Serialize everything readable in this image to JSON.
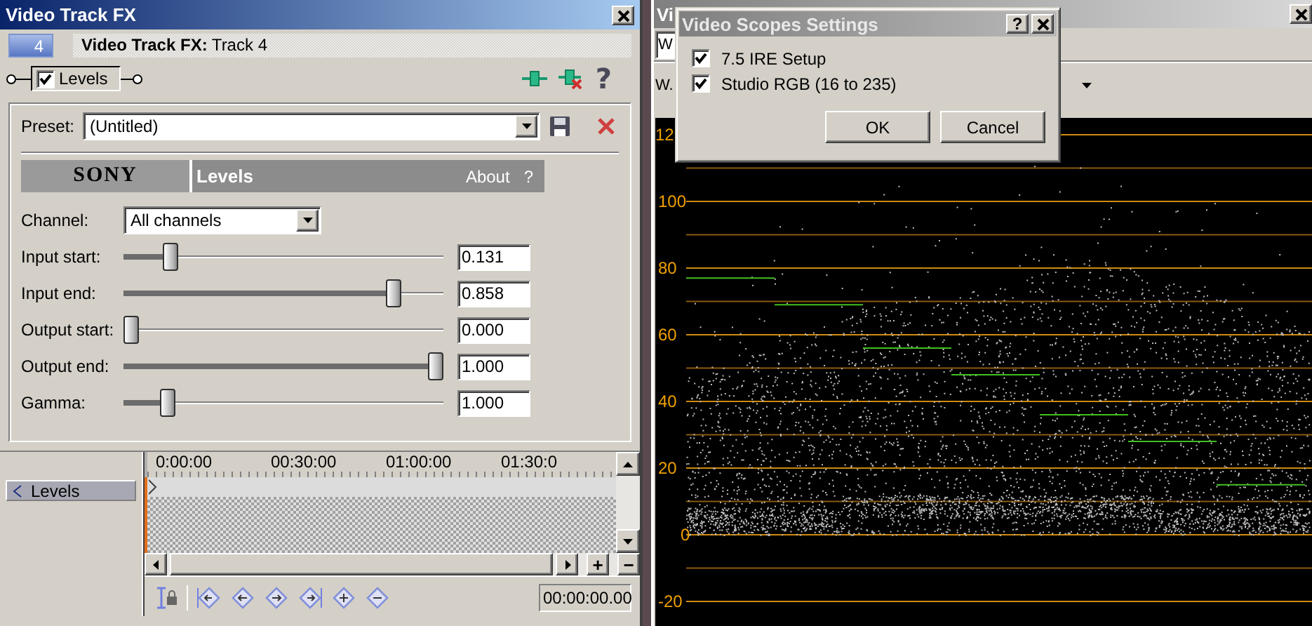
{
  "fx_window": {
    "title": "Video Track FX",
    "track_badge": "4",
    "header": "**Video Track FX:** Track 4",
    "chain": {
      "label": "Levels",
      "checked": true
    },
    "help_glyph": "?",
    "preset": {
      "label": "Preset:",
      "value": "(Untitled)"
    },
    "plugin_banner": {
      "brand": "SONY",
      "name": "Levels",
      "about": "About",
      "help": "?"
    },
    "channel": {
      "label": "Channel:",
      "value": "All channels"
    },
    "params": [
      {
        "label": "Input start:",
        "level": 0.13,
        "value": "0.131"
      },
      {
        "label": "Input end:",
        "level": 0.86,
        "value": "0.858"
      },
      {
        "label": "Output start:",
        "level": 0,
        "value": "0.000"
      },
      {
        "label": "Output end:",
        "level": 1,
        "value": "1.000"
      },
      {
        "label": "Gamma:",
        "level": 0.12,
        "value": "1.000"
      }
    ],
    "keyframes": {
      "tracks": [
        {
          "label": "Levels",
          "selected": true
        }
      ],
      "ruler": [
        "0:00:00",
        "00:30:00",
        "01:00:00",
        "01:30:0"
      ],
      "zoom_in": "+",
      "zoom_out": "−",
      "time": "00:00:00.00"
    }
  },
  "scope_window": {
    "title": "Vi",
    "field_value": "W",
    "mode_label": "W.",
    "axis_labels": [
      "12",
      "100",
      "80",
      "60",
      "40",
      "20",
      "0",
      "-20"
    ]
  },
  "dialog": {
    "title": "Video Scopes Settings",
    "help": "?",
    "options": [
      {
        "label": "7.5 IRE Setup",
        "checked": true
      },
      {
        "label": "Studio RGB (16 to 235)",
        "checked": true
      }
    ],
    "buttons": [
      "OK",
      "Cancel"
    ]
  }
}
